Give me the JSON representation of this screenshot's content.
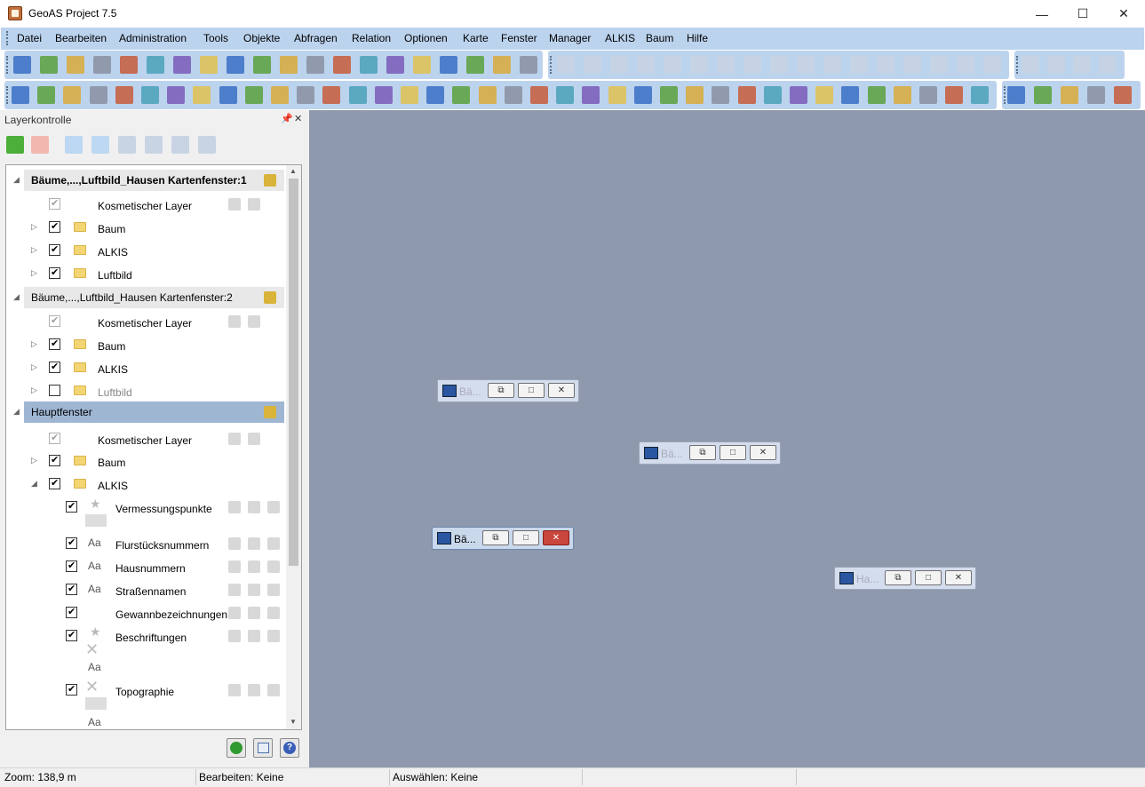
{
  "window": {
    "title": "GeoAS Project 7.5",
    "minimize": "—",
    "maximize": "☐",
    "close": "✕"
  },
  "menu": [
    "Datei",
    "Bearbeiten",
    "Administration",
    "Tools",
    "Objekte",
    "Abfragen",
    "Relation",
    "Optionen",
    "Karte",
    "Fenster",
    "Manager",
    "ALKIS",
    "Baum",
    "Hilfe"
  ],
  "toolbar_row1_left": [
    "save-icon",
    "print-icon",
    "pdf-icon",
    "cut-icon",
    "copy-icon",
    "paste-icon",
    "undo-icon",
    "table-icon",
    "table-view-icon",
    "globe-icon",
    "chart-icon",
    "page-icon",
    "window-icon",
    "map-green-icon",
    "map-edit-icon",
    "map-pin-icon",
    "map-flag-icon",
    "sort-az-icon",
    "search-map-icon",
    "help-icon"
  ],
  "toolbar_row1_mid": [
    "pin-icon",
    "line-icon",
    "polyline-icon",
    "arc-icon",
    "polygon-icon",
    "circle-icon",
    "rectangle-icon",
    "rounded-rect-icon",
    "text-tool-icon",
    "frame-icon",
    "node-polygon-icon",
    "node-star-icon",
    "snap-icon",
    "split-line-icon",
    "house-icon",
    "label-a-icon",
    "grid-edit-icon"
  ],
  "toolbar_row1_right": [
    "back-icon",
    "fit-icon",
    "forward-icon",
    "zoom-search-icon"
  ],
  "toolbar_row2": [
    "select-arrow-icon",
    "select-rect-icon",
    "select-circle-icon",
    "select-polygon-icon",
    "select-poly2-icon",
    "select-exclude-icon",
    "select-all-icon",
    "pencil-icon",
    "edit-vertex-icon",
    "zoom-in-icon",
    "zoom-out-icon",
    "zoom-extent-icon",
    "pan-hand-icon",
    "measure-icon",
    "info-icon",
    "golf-flag-icon",
    "tag-icon",
    "map-pointer-icon",
    "layers-icon",
    "ruler-icon",
    "tape-icon",
    "legend-icon",
    "table-delete-icon",
    "sum-icon",
    "merge-icon",
    "copy-feature-icon",
    "move-feature-icon",
    "envelope-icon",
    "car-icon",
    "scale-bar-icon",
    "list-icon",
    "filter-icon",
    "disk-icon",
    "excel-icon",
    "wave-icon",
    "save-yellow-icon",
    "refresh-icon",
    "house-tool-icon"
  ],
  "toolbar_row2_right": [
    "add-layer-icon",
    "remove-layer-icon",
    "move-layer-icon",
    "edit-layer-icon",
    "layer-settings-icon"
  ],
  "panel": {
    "title": "Layerkontrolle",
    "pin": "📌",
    "close": "✕",
    "tools": [
      "add-icon",
      "delete-icon",
      "up-icon",
      "down-icon",
      "layer-stack-icon",
      "layer-refresh-icon",
      "layer-edit-icon",
      "sort-icon"
    ],
    "groups": [
      {
        "label": "Bäume,...,Luftbild_Hausen Kartenfenster:1",
        "style": "bold"
      },
      {
        "label": "Bäume,...,Luftbild_Hausen Kartenfenster:2",
        "style": "normal"
      },
      {
        "label": "Hauptfenster",
        "style": "selected"
      }
    ],
    "rows": {
      "g1_kos": "Kosmetischer Layer",
      "g1_baum": "Baum",
      "g1_alkis": "ALKIS",
      "g1_luft": "Luftbild",
      "g2_kos": "Kosmetischer Layer",
      "g2_baum": "Baum",
      "g2_alkis": "ALKIS",
      "g2_luft": "Luftbild",
      "g3_kos": "Kosmetischer Layer",
      "g3_baum": "Baum",
      "g3_alkis": "ALKIS",
      "verm": "Vermessungspunkte",
      "flur": "Flurstücksnummern",
      "haus": "Hausnummern",
      "strasse": "Straßennamen",
      "gewann": "Gewannbezeichnungen",
      "beschr": "Beschriftungen",
      "topo": "Topographie"
    },
    "aa": "Aa",
    "bottom": [
      "ok-circle-icon",
      "table-export-icon",
      "help-icon"
    ]
  },
  "windows": [
    {
      "title": "Bä..."
    },
    {
      "title": "Bä..."
    },
    {
      "title": "Bä..."
    },
    {
      "title": "Ha..."
    }
  ],
  "status": {
    "zoom": "Zoom: 138,9 m",
    "edit": "Bearbeiten: Keine",
    "select": "Auswählen: Keine"
  },
  "colors": {
    "toolbar": "#bcd3ee",
    "map": "#8e99ad",
    "selected": "#9fb6d3"
  }
}
